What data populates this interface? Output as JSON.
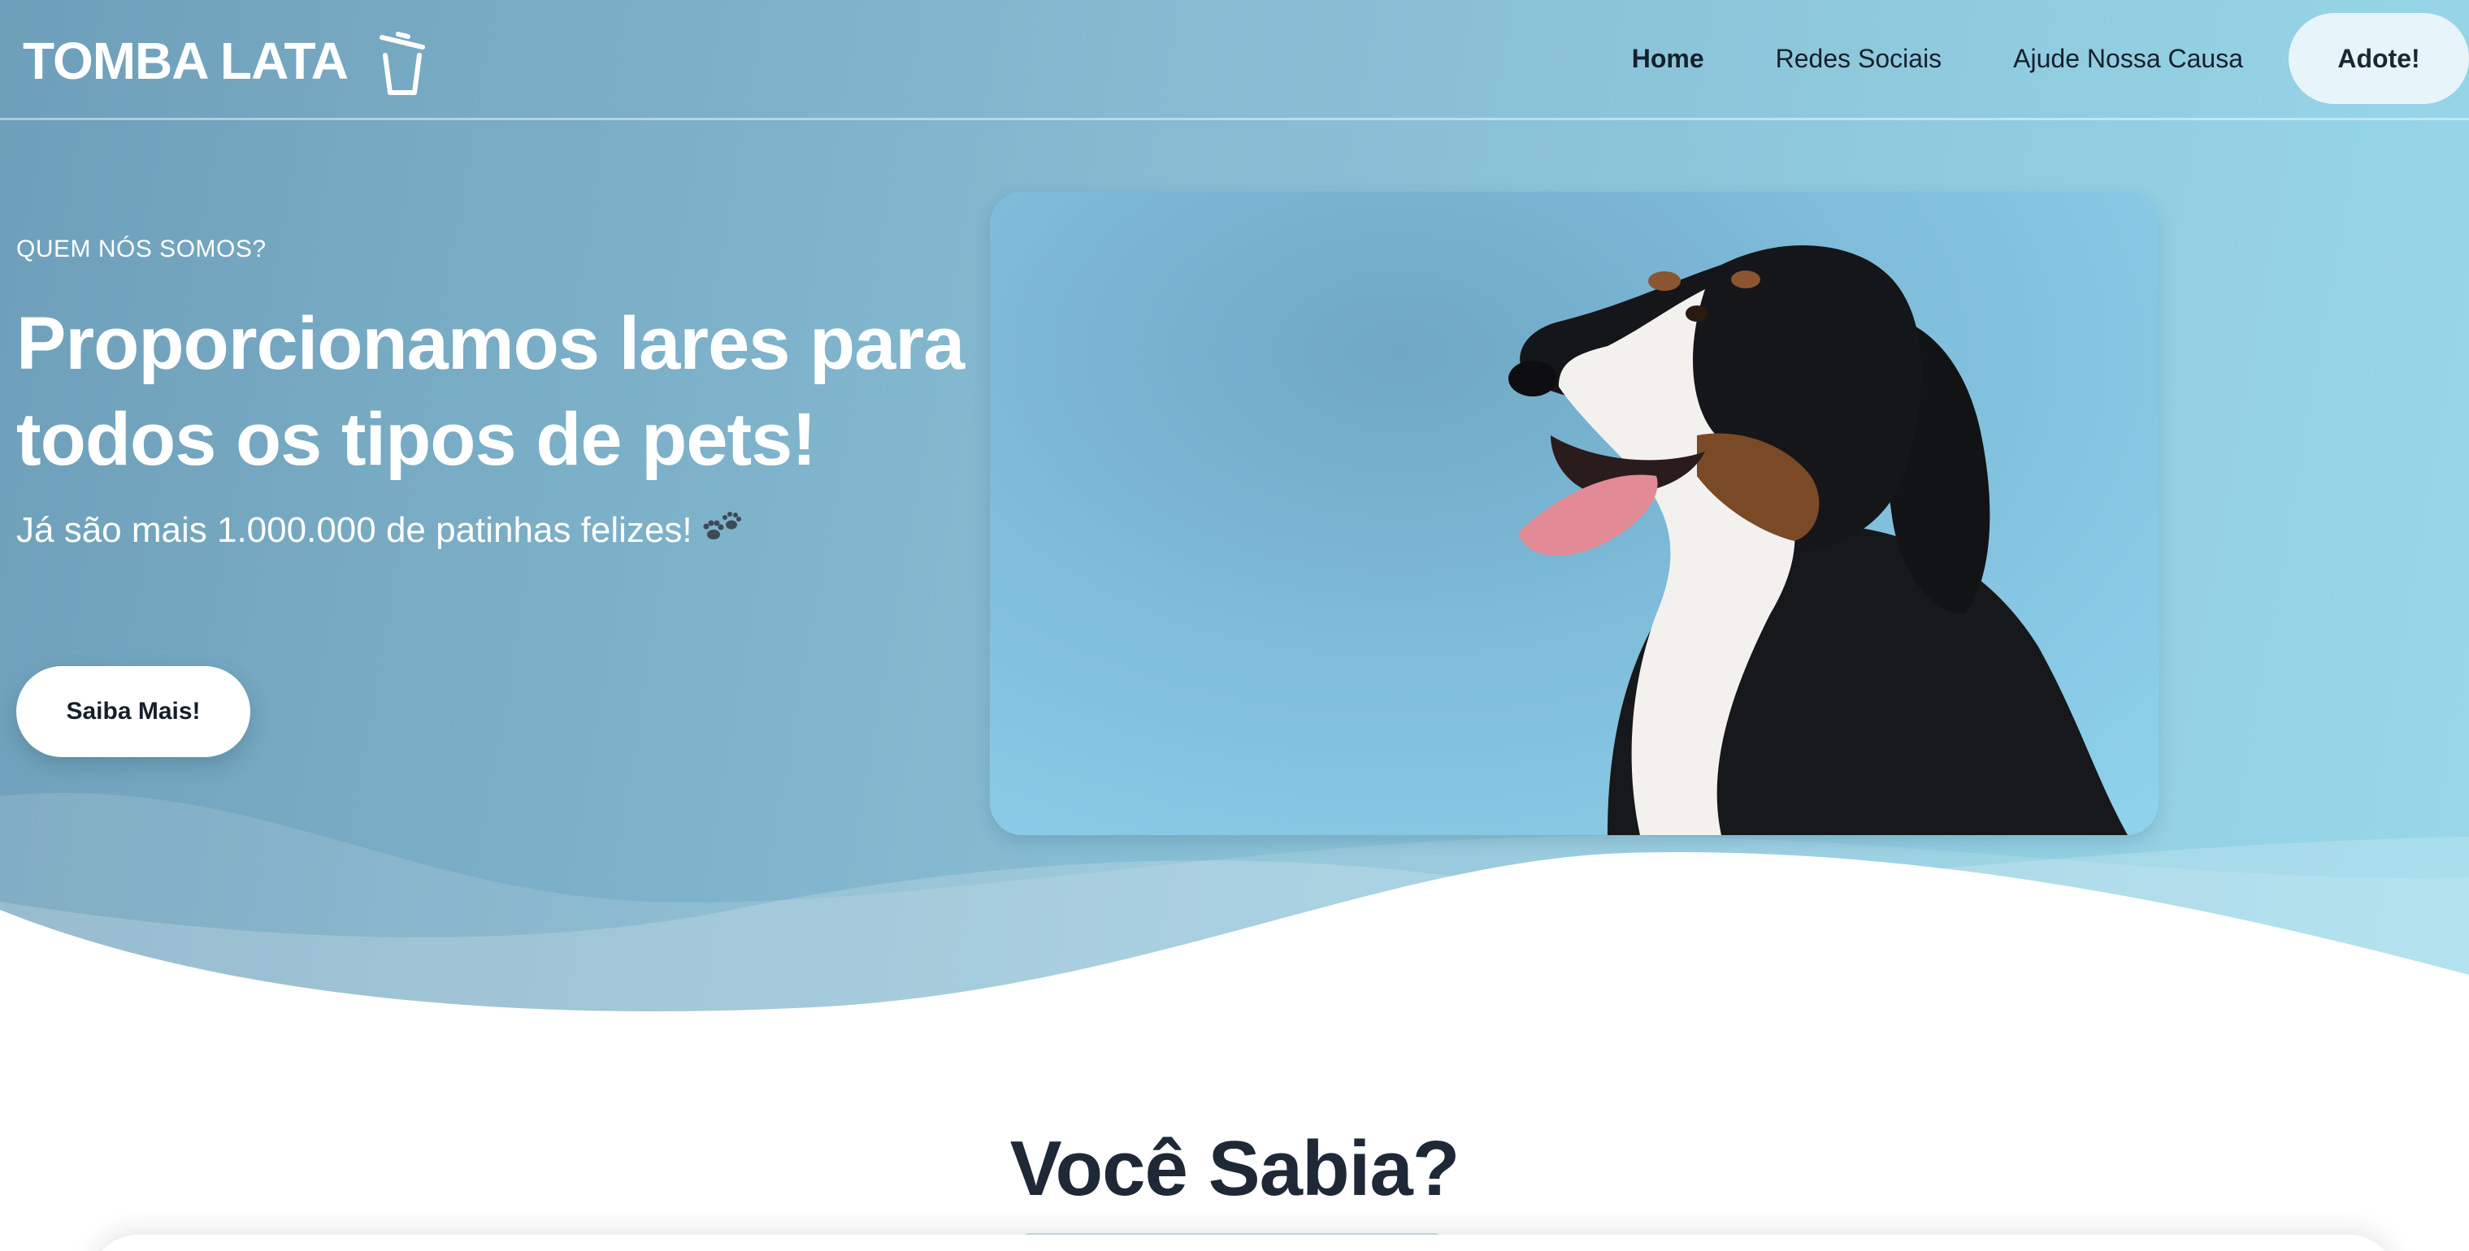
{
  "brand": {
    "name": "TOMBA LATA",
    "icon": "trash-can-icon"
  },
  "nav": {
    "items": [
      {
        "label": "Home",
        "active": true
      },
      {
        "label": "Redes Sociais",
        "active": false
      },
      {
        "label": "Ajude Nossa Causa",
        "active": false
      }
    ],
    "cta_label": "Adote!"
  },
  "hero": {
    "eyebrow": "QUEM NÓS SOMOS?",
    "headline_line1": "Proporcionamos lares para",
    "headline_line2": "todos os tipos de pets!",
    "subline": "Já são mais 1.000.000 de patinhas felizes!",
    "subline_icon": "paw-prints-icon",
    "button_label": "Saiba Mais!",
    "image": "bernese-mountain-dog-photo"
  },
  "section": {
    "title": "Você Sabia?"
  },
  "colors": {
    "hero_gradient_start": "#6e9fba",
    "hero_gradient_end": "#98d8ea",
    "text_dark": "#1e2836",
    "cta_bg": "#e7f4f9"
  }
}
